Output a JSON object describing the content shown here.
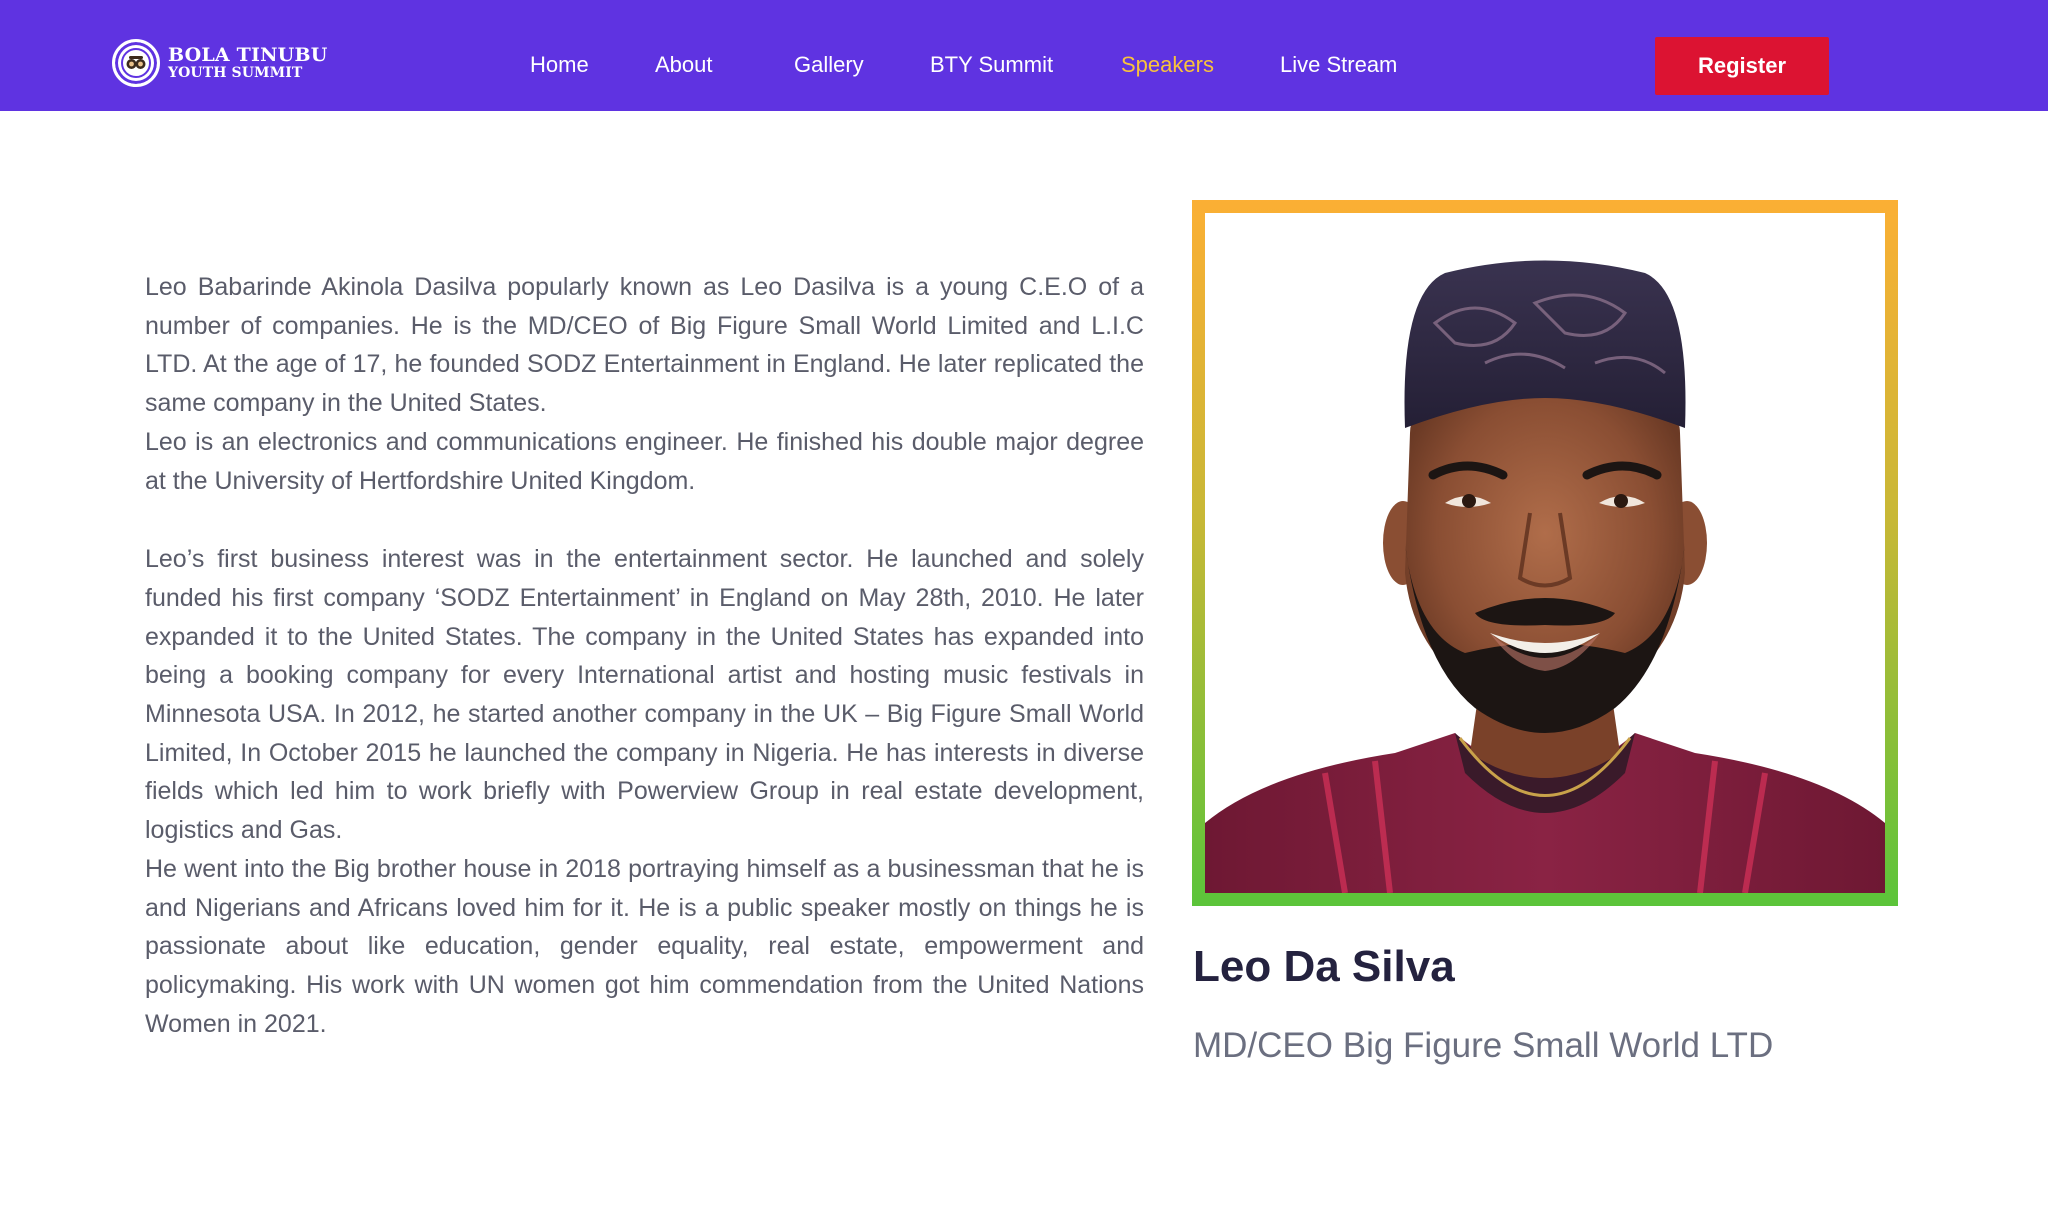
{
  "brand": {
    "logo_line1": "BOLA TINUBU",
    "logo_line2": "YOUTH SUMMIT",
    "logo_icon": "summit-emblem-icon",
    "primary_color": "#5f33e1",
    "accent_color": "#f9c23c",
    "cta_color": "#dc1332"
  },
  "nav": {
    "items": [
      {
        "label": "Home",
        "active": false
      },
      {
        "label": "About",
        "active": false
      },
      {
        "label": "Gallery",
        "active": false
      },
      {
        "label": "BTY Summit",
        "active": false
      },
      {
        "label": "Speakers",
        "active": true
      },
      {
        "label": "Live Stream",
        "active": false
      }
    ],
    "register_label": "Register"
  },
  "speaker": {
    "name": "Leo Da Silva",
    "role": "MD/CEO Big Figure Small World LTD",
    "photo_icon": "speaker-portrait-image",
    "bio": [
      "Leo Babarinde Akinola Dasilva popularly known as Leo Dasilva is a young C.E.O of a number of companies. He is the MD/CEO of Big Figure Small World Limited and L.I.C LTD. At the age of 17, he founded SODZ Entertainment in England. He later replicated the same company in the United States.",
      "Leo is an electronics and communications engineer. He finished his double major degree at the University of Hertfordshire United Kingdom.",
      "Leo’s first business interest was in the entertainment sector. He launched and solely funded his first company ‘SODZ Entertainment’ in England on May 28th, 2010. He later expanded it to the United States. The company in the United States has expanded into being a booking company for every International artist and hosting music festivals in Minnesota USA. In 2012, he started another company in the UK – Big Figure Small World Limited, In October 2015 he launched the company in Nigeria. He has interests in diverse fields which led him to work briefly with Powerview Group in real estate development, logistics and Gas.",
      "He went into the Big brother house in 2018 portraying himself as a businessman that he is and Nigerians and Africans loved him for it. He is a public speaker mostly on things he is passionate about like education, gender equality, real estate, empowerment and policymaking. His work with UN women got him commendation from the United Nations Women in 2021."
    ]
  }
}
